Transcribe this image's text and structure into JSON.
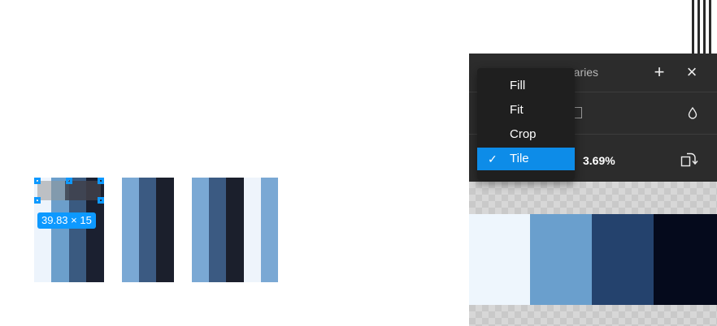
{
  "canvas": {
    "stripes": [
      {
        "color": "#edf4fc",
        "w": 21
      },
      {
        "color": "#6c9fcb",
        "w": 22
      },
      {
        "color": "#3a5a80",
        "w": 21
      },
      {
        "color": "#1b2030",
        "w": 22
      },
      {
        "color": "#ffffff",
        "w": 22
      },
      {
        "color": "#7aa8d4",
        "w": 21
      },
      {
        "color": "#3b5a82",
        "w": 21
      },
      {
        "color": "#1b1f2c",
        "w": 22
      },
      {
        "color": "#ffffff",
        "w": 22
      },
      {
        "color": "#7aa8d4",
        "w": 21
      },
      {
        "color": "#3b5a82",
        "w": 21
      },
      {
        "color": "#1b1f2c",
        "w": 22
      },
      {
        "color": "#eef4fb",
        "w": 21
      },
      {
        "color": "#7aa8d4",
        "w": 21
      }
    ],
    "dimension_label": "39.83 × 15"
  },
  "panel": {
    "title": "raries",
    "add_icon": "+",
    "close_icon": "×",
    "zoom_value": "3.69%",
    "preview_colors": [
      "#eef6fd",
      "#6a9fcd",
      "#24426d",
      "#050a1c"
    ]
  },
  "menu": {
    "items": [
      {
        "label": "Fill",
        "selected": false
      },
      {
        "label": "Fit",
        "selected": false
      },
      {
        "label": "Crop",
        "selected": false
      },
      {
        "label": "Tile",
        "selected": true
      }
    ],
    "check_glyph": "✓"
  },
  "colors": {
    "accent": "#0d99ff",
    "menu_selected": "#0d8ce8",
    "panel_bg": "#2c2c2c"
  }
}
